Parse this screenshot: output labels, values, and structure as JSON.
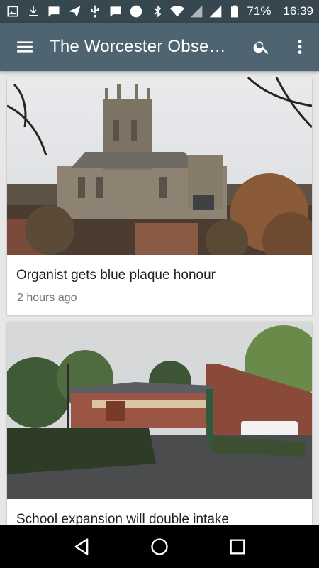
{
  "status_bar": {
    "battery": "71%",
    "time": "16:39",
    "icons": [
      "image-icon",
      "download-icon",
      "chat-bubble-icon",
      "send-icon",
      "usb-icon",
      "chat-bubble-icon",
      "circle-icon",
      "bluetooth-icon",
      "wifi-icon",
      "signal-icon",
      "signal-icon",
      "battery-icon"
    ]
  },
  "app_bar": {
    "title": "The Worcester Obser…",
    "icons": [
      "menu-icon",
      "search-icon",
      "more-vert-icon"
    ]
  },
  "articles": [
    {
      "title": "Organist gets blue plaque honour",
      "time": "2 hours ago"
    },
    {
      "title": "School expansion will double intake",
      "time": ""
    }
  ],
  "nav_bar": {
    "icons": [
      "back-icon",
      "home-icon",
      "recents-icon"
    ]
  },
  "colors": {
    "status_bar": "#37474f",
    "app_bar": "#4e6470",
    "background": "#e7e7e7"
  }
}
